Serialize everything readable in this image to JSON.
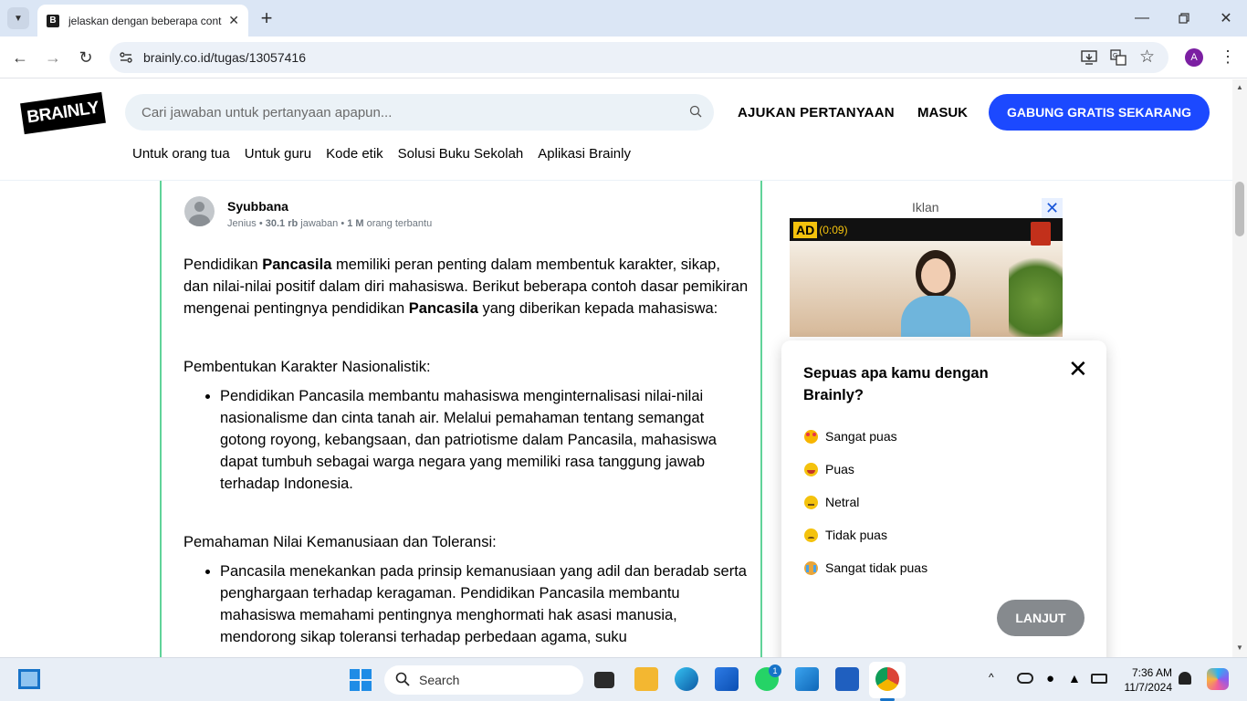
{
  "browser": {
    "tab_title": "jelaskan dengan beberapa cont",
    "tab_favicon": "B",
    "url": "brainly.co.id/tugas/13057416",
    "new_tab_label": "+",
    "profile_initial": "A"
  },
  "header": {
    "logo": "BRAINLY",
    "search_placeholder": "Cari jawaban untuk pertanyaan apapun...",
    "ask_label": "AJUKAN PERTANYAAN",
    "login_label": "MASUK",
    "join_label": "GABUNG GRATIS SEKARANG",
    "subnav": [
      "Untuk orang tua",
      "Untuk guru",
      "Kode etik",
      "Solusi Buku Sekolah",
      "Aplikasi Brainly"
    ]
  },
  "answer": {
    "author": "Syubbana",
    "rank": "Jenius",
    "answers_count": "30.1 rb",
    "answers_label": "jawaban",
    "helped_count": "1 M",
    "helped_label": "orang terbantu",
    "intro_1": "Pendidikan ",
    "intro_bold_1": "Pancasila",
    "intro_2": " memiliki peran penting dalam membentuk karakter, sikap, dan nilai-nilai positif dalam diri mahasiswa. Berikut beberapa contoh dasar pemikiran mengenai pentingnya pendidikan ",
    "intro_bold_2": "Pancasila",
    "intro_3": " yang diberikan kepada mahasiswa:",
    "section1_title": "Pembentukan Karakter Nasionalistik:",
    "section1_bullet": "Pendidikan Pancasila membantu mahasiswa menginternalisasi nilai-nilai nasionalisme dan cinta tanah air. Melalui pemahaman tentang semangat gotong royong, kebangsaan, dan patriotisme dalam Pancasila, mahasiswa dapat tumbuh sebagai warga negara yang memiliki rasa tanggung jawab terhadap Indonesia.",
    "section2_title": "Pemahaman Nilai Kemanusiaan dan Toleransi:",
    "section2_bullet": "Pancasila menekankan pada prinsip kemanusiaan yang adil dan beradab serta penghargaan terhadap keragaman. Pendidikan Pancasila membantu mahasiswa memahami pentingnya menghormati hak asasi manusia, mendorong sikap toleransi terhadap perbedaan agama, suku"
  },
  "ad": {
    "label": "Iklan",
    "badge": "AD",
    "timer": "(0:09)"
  },
  "feedback": {
    "title": "Sepuas apa kamu dengan Brainly?",
    "options": [
      "Sangat puas",
      "Puas",
      "Netral",
      "Tidak puas",
      "Sangat tidak puas"
    ],
    "next_label": "LANJUT"
  },
  "taskbar": {
    "search_label": "Search",
    "whatsapp_badge": "1",
    "time": "7:36 AM",
    "date": "11/7/2024"
  }
}
